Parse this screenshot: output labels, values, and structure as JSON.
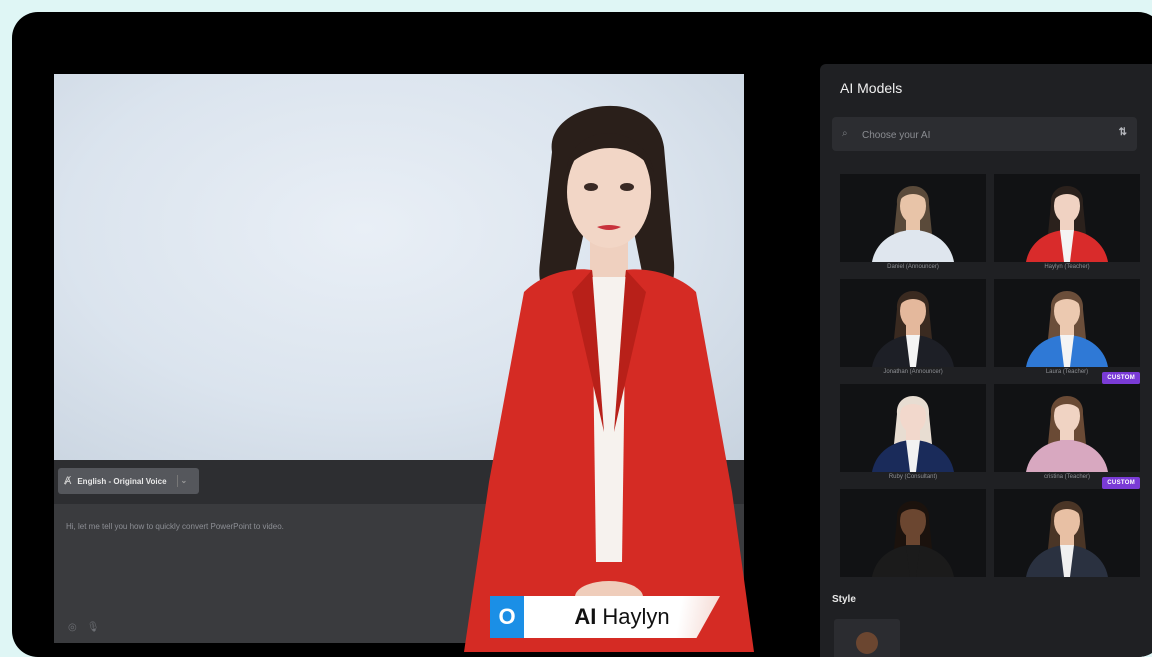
{
  "editor": {
    "voice_label": "English - Original Voice",
    "voice_icon": "translate-icon",
    "script_text": "Hi, let me tell you how to quickly convert PowerPoint to video."
  },
  "presenter": {
    "name_prefix": "AI",
    "name": "Haylyn"
  },
  "panel": {
    "title": "AI Models",
    "search_placeholder": "Choose your AI",
    "style_label": "Style",
    "models": [
      {
        "caption": "Daniel (Announcer)",
        "badge": "",
        "skin": "#e8c4a8",
        "hair": "#5a4a3a",
        "shirt": "#dfe6ee",
        "jacket": "#dfe6ee"
      },
      {
        "caption": "Haylyn (Teacher)",
        "badge": "",
        "skin": "#f0d2c2",
        "hair": "#2b211c",
        "shirt": "#f4f4f4",
        "jacket": "#d92b2b"
      },
      {
        "caption": "Jonathan (Announcer)",
        "badge": "",
        "skin": "#e4b89c",
        "hair": "#3a2a20",
        "shirt": "#f4f4f4",
        "jacket": "#1d1f26"
      },
      {
        "caption": "Laura (Teacher)",
        "badge": "",
        "skin": "#ecc9b0",
        "hair": "#6b4e3a",
        "shirt": "#f4f4f4",
        "jacket": "#2f79d6"
      },
      {
        "caption": "Ruby (Consultant)",
        "badge": "",
        "skin": "#f2d8cc",
        "hair": "#e8ddd2",
        "shirt": "#f2f2f2",
        "jacket": "#1a2b5a"
      },
      {
        "caption": "cristina (Teacher)",
        "badge": "CUSTOM",
        "skin": "#f0d3c3",
        "hair": "#6a4a35",
        "shirt": "#d8a8c0",
        "jacket": "#d8a8c0"
      },
      {
        "caption": "",
        "badge": "",
        "skin": "#6b4630",
        "hair": "#1b120d",
        "shirt": "#1b1b1b",
        "jacket": "#1b1b1b"
      },
      {
        "caption": "",
        "badge": "CUSTOM",
        "skin": "#e8c0a4",
        "hair": "#4a3526",
        "shirt": "#f0f0f0",
        "jacket": "#2a3140"
      }
    ]
  }
}
